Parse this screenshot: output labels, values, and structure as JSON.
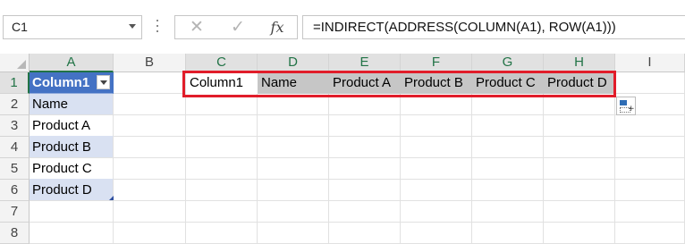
{
  "formula_bar": {
    "name_box": "C1",
    "cancel_icon": "✕",
    "enter_icon": "✓",
    "fx_label": "fx",
    "formula": "=INDIRECT(ADDRESS(COLUMN(A1), ROW(A1)))"
  },
  "columns": [
    "A",
    "B",
    "C",
    "D",
    "E",
    "F",
    "G",
    "H",
    "I"
  ],
  "rows": [
    "1",
    "2",
    "3",
    "4",
    "5",
    "6",
    "7",
    "8"
  ],
  "table": {
    "header": "Column1",
    "items": [
      "Name",
      "Product A",
      "Product B",
      "Product C",
      "Product D"
    ]
  },
  "result_row": [
    "Column1",
    "Name",
    "Product A",
    "Product B",
    "Product C",
    "Product D"
  ],
  "colors": {
    "table_header": "#4472c4",
    "table_band": "#d9e1f2",
    "highlight_box": "#e11d2a",
    "selected_header": "#217346"
  }
}
